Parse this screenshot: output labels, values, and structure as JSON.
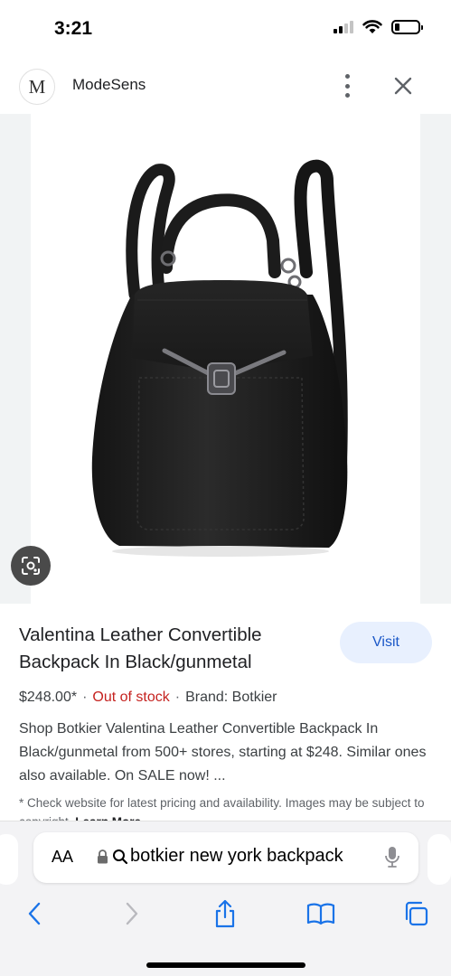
{
  "status": {
    "time": "3:21"
  },
  "site": {
    "avatar_letter": "M",
    "name": "ModeSens"
  },
  "result": {
    "title": "Valentina Leather Convertible Backpack In Black/gunmetal",
    "visit_label": "Visit",
    "price": "$248.00*",
    "stock": "Out of stock",
    "brand": "Brand: Botkier",
    "description": "Shop Botkier Valentina Leather Convertible Backpack In Black/gunmetal from 500+ stores, starting at $248. Similar ones also available. On SALE now! ...",
    "disclaimer": "* Check website for latest pricing and availability. Images may be subject to copyright.",
    "learn_more": "Learn More"
  },
  "browser": {
    "aa_label": "AA",
    "url": "botkier new york backpack"
  },
  "colors": {
    "accent": "#1a57c7",
    "visit_bg": "#e8f0fe",
    "out_of_stock": "#c5221f"
  },
  "icons": [
    "signal-icon",
    "wifi-icon",
    "battery-icon",
    "more-vert-icon",
    "close-icon",
    "lens-icon",
    "lock-icon",
    "search-icon",
    "mic-icon",
    "back-icon",
    "forward-icon",
    "share-icon",
    "bookmarks-icon",
    "tabs-icon"
  ]
}
